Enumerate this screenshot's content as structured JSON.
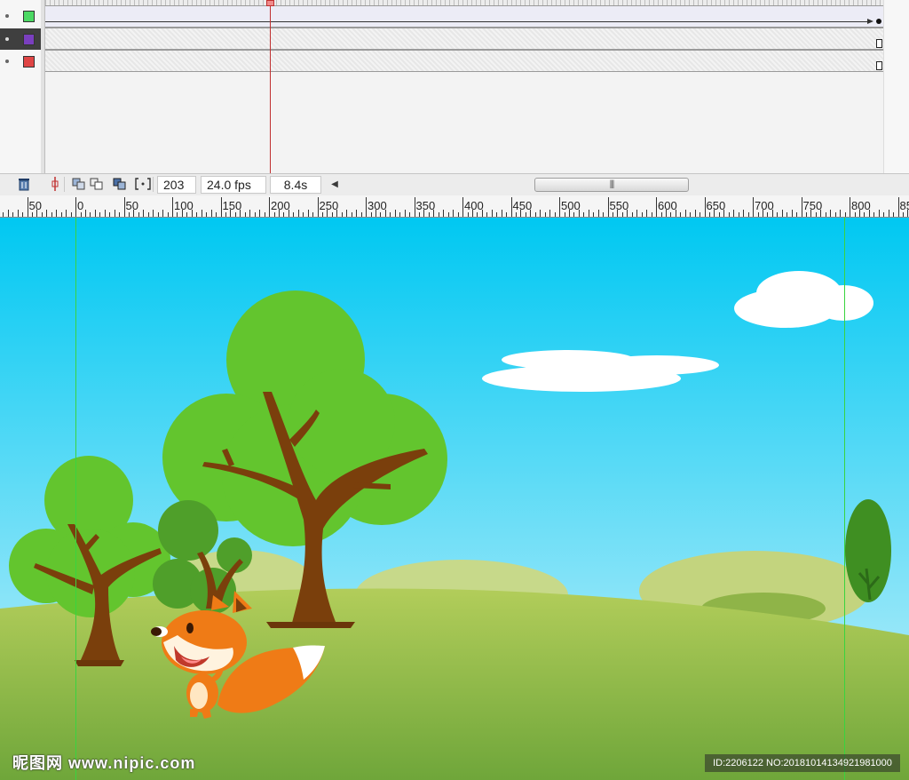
{
  "timeline": {
    "layers": [
      {
        "color": "#4cd964"
      },
      {
        "color": "#7a3fbf"
      },
      {
        "color": "#e04545"
      }
    ],
    "status": {
      "current_frame": "203",
      "frame_rate": "24.0 fps",
      "elapsed_time": "8.4s"
    },
    "icons": {
      "delete": "trash-icon",
      "center_frame": "center-frame-icon",
      "onion_skin": "onion-skin-icon",
      "onion_outlines": "onion-skin-outlines-icon",
      "edit_multiple": "edit-multiple-frames-icon",
      "onion_markers": "onion-markers-icon",
      "scroll_left": "scroll-left-arrow-icon"
    }
  },
  "ruler": {
    "labels": [
      "50",
      "0",
      "50",
      "100",
      "150",
      "200",
      "250",
      "300",
      "350",
      "400",
      "450",
      "500",
      "550",
      "600",
      "650",
      "700",
      "750",
      "800",
      "85"
    ]
  },
  "stage": {
    "sky_top": "#00c8f2",
    "sky_bottom": "#bfeefb",
    "grass": "#8cbf3c",
    "tree_green": "#63c52e",
    "trunk": "#7a3f0c",
    "fox": "#ef7b16"
  },
  "watermark": {
    "site": "昵图网 www.nipic.com",
    "id_text": "ID:2206122 NO:20181014134921981000"
  }
}
